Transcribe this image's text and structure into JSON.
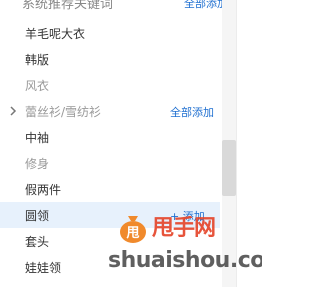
{
  "panel": {
    "title": "系统推荐关键词",
    "title_action": "全部添加"
  },
  "items": [
    {
      "label": "羊毛呢大衣",
      "style": "dark"
    },
    {
      "label": "韩版",
      "style": "dark"
    },
    {
      "label": "风衣",
      "style": "grey"
    },
    {
      "label": "蕾丝衫/雪纺衫",
      "style": "grey",
      "has_chevron": true,
      "action": "全部添加"
    },
    {
      "label": "中袖",
      "style": "dark"
    },
    {
      "label": "修身",
      "style": "grey"
    },
    {
      "label": "假两件",
      "style": "dark"
    },
    {
      "label": "圆领",
      "style": "dark",
      "selected": true,
      "action": "+ 添加"
    },
    {
      "label": "套头",
      "style": "dark"
    },
    {
      "label": "娃娃领",
      "style": "dark"
    }
  ],
  "watermark": {
    "brand_cn": "甩手网",
    "brand_en": "shuaishou.com"
  },
  "colors": {
    "link": "#1f6fd0",
    "selected_bg": "#e7f1fc",
    "text_dark": "#333333",
    "text_grey": "#999999"
  },
  "icons": {
    "chevron": "chevron-right-icon",
    "watermark_logo": "money-bag-icon"
  }
}
